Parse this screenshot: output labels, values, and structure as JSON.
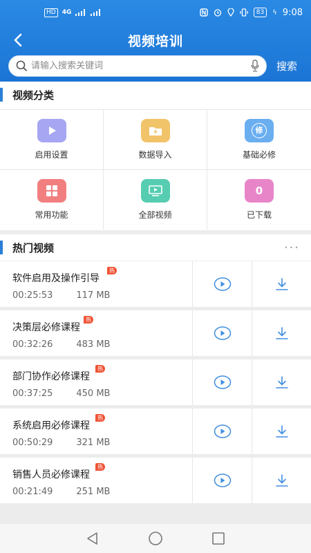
{
  "status_bar": {
    "network": "4G",
    "battery": "83",
    "time": "9:08"
  },
  "header": {
    "title": "视频培训"
  },
  "search": {
    "placeholder": "请输入搜索关键词",
    "button_label": "搜索"
  },
  "categories": {
    "title": "视频分类",
    "items": [
      {
        "label": "启用设置",
        "icon": "play-icon",
        "color": "#a6a6f2"
      },
      {
        "label": "数据导入",
        "icon": "folder-import-icon",
        "color": "#f2c46a"
      },
      {
        "label": "基础必修",
        "icon": "required-icon",
        "color": "#6aaef0",
        "glyph": "修"
      },
      {
        "label": "常用功能",
        "icon": "apps-icon",
        "color": "#f27f7f"
      },
      {
        "label": "全部视频",
        "icon": "video-icon",
        "color": "#56cdb0"
      },
      {
        "label": "已下载",
        "icon": "downloaded-count-icon",
        "color": "#e885c9",
        "glyph": "0"
      }
    ]
  },
  "hot_videos": {
    "title": "热门视频",
    "hot_badge": "热",
    "items": [
      {
        "title": "软件启用及操作引导",
        "duration": "00:25:53",
        "size": "117 MB"
      },
      {
        "title": "决策层必修课程",
        "duration": "00:32:26",
        "size": "483 MB"
      },
      {
        "title": "部门协作必修课程",
        "duration": "00:37:25",
        "size": "450 MB"
      },
      {
        "title": "系统启用必修课程",
        "duration": "00:50:29",
        "size": "321 MB"
      },
      {
        "title": "销售人员必修课程",
        "duration": "00:21:49",
        "size": "251 MB"
      }
    ]
  }
}
